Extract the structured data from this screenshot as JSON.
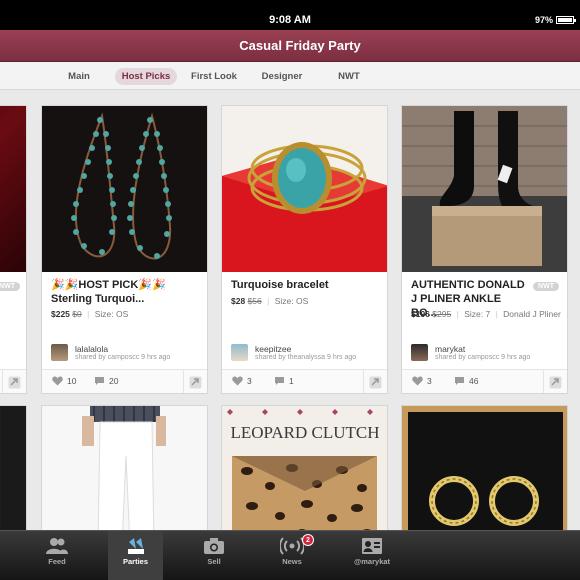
{
  "status_bar": {
    "time": "9:08 AM",
    "battery": "97%",
    "battery_level": 0.97
  },
  "header": {
    "title": "Casual Friday Party"
  },
  "tabs": [
    {
      "label": "Main",
      "active": false
    },
    {
      "label": "Host Picks",
      "active": true
    },
    {
      "label": "First Look",
      "active": false
    },
    {
      "label": "Designer",
      "active": false
    },
    {
      "label": "NWT",
      "active": false
    }
  ],
  "listings_row1": [
    {
      "partial": true,
      "badge": "NWT"
    },
    {
      "title": "🎉🎉HOST PICK🎉🎉Sterling Turquoi...",
      "price": "$225",
      "original_price": "$0",
      "size": "Size: OS",
      "brand": "",
      "user": "lalalalola",
      "shared": "shared by camposcc 9 hrs ago",
      "likes": "10",
      "comments": "20"
    },
    {
      "title": "Turquoise bracelet",
      "price": "$28",
      "original_price": "$56",
      "size": "Size: OS",
      "brand": "",
      "user": "keepitzee",
      "shared": "shared by theanalyssa 9 hrs ago",
      "likes": "3",
      "comments": "1"
    },
    {
      "title": "AUTHENTIC DONALD J PLINER ANKLE BO...",
      "badge": "NWT",
      "price": "$196",
      "original_price": "$295",
      "size": "Size: 7",
      "brand": "Donald J Pliner",
      "user": "marykat",
      "shared": "shared by camposcc 9 hrs ago",
      "likes": "3",
      "comments": "46"
    }
  ],
  "listings_row2": [
    {
      "image": "dark-partial"
    },
    {
      "image": "white-jeans"
    },
    {
      "image": "leopard-clutch",
      "image_text": "LEOPARD CLUTCH"
    },
    {
      "image": "gold-hoops"
    }
  ],
  "bottom_nav": [
    {
      "label": "Feed",
      "icon": "people-icon",
      "active": false
    },
    {
      "label": "Parties",
      "icon": "party-icon",
      "active": true
    },
    {
      "label": "Sell",
      "icon": "camera-icon",
      "active": false
    },
    {
      "label": "News",
      "icon": "broadcast-icon",
      "active": false,
      "badge": "2"
    },
    {
      "label": "@marykat",
      "icon": "profile-card-icon",
      "active": false
    }
  ],
  "colors": {
    "brand": "#7c2e41",
    "background": "#e9e9e9"
  }
}
